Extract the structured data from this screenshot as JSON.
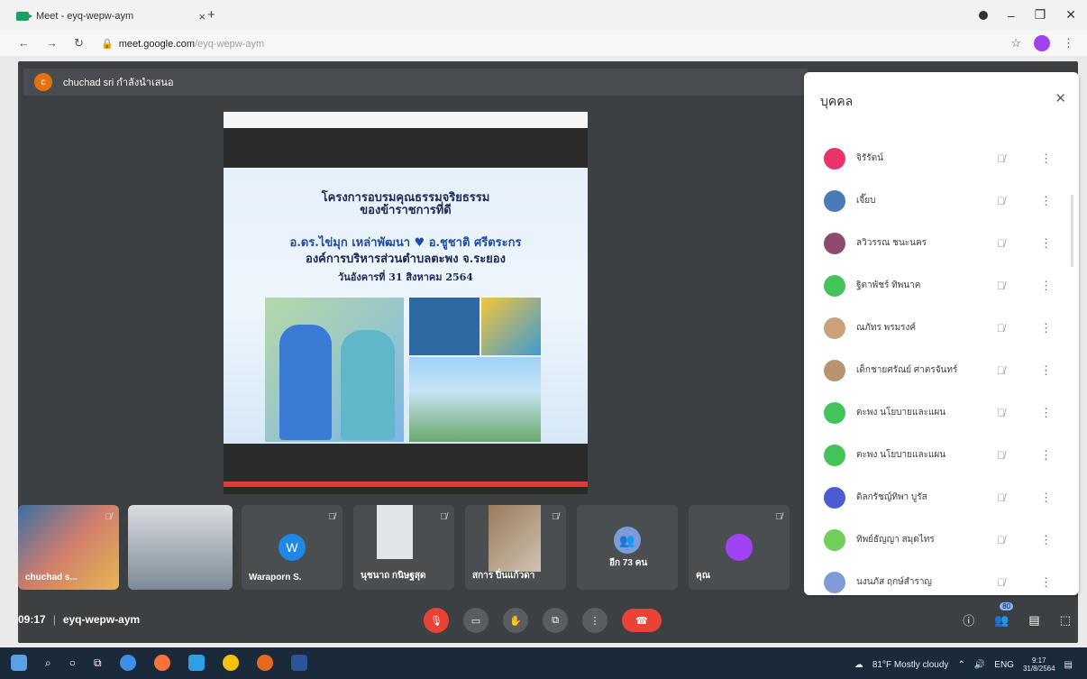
{
  "browser": {
    "tab_title": "Meet - eyq-wepw-aym",
    "tab_close": "×",
    "new_tab": "+",
    "url_host": "meet.google.com",
    "url_path": "/eyq-wepw-aym"
  },
  "presenter": {
    "avatar_initial": "c",
    "text": "chuchad sri กำลังนำเสนอ"
  },
  "slide": {
    "line1": "โครงการอบรมคุณธรรมจริยธรรม",
    "line2": "ของข้าราชการที่ดี",
    "line3": "อ.ดร.ไข่มุก เหล่าพัฒนา ♥ อ.ชูชาติ ศรีตระกร",
    "line4": "องค์การบริหารส่วนตำบลตะพง จ.ระยอง",
    "line5": "วันอังคารที่ 31 สิงหาคม 2564"
  },
  "tiles": [
    {
      "name": "chuchad s...",
      "initial": ""
    },
    {
      "name": "",
      "initial": ""
    },
    {
      "name": "Waraporn S.",
      "initial": "W"
    },
    {
      "name": "นุชนาถ กนิษฐสุด",
      "initial": ""
    },
    {
      "name": "สการ ปิ่นแก้วดา",
      "initial": ""
    },
    {
      "name": "อีก 73 คน",
      "initial": ""
    },
    {
      "name": "คุณ",
      "initial": ""
    }
  ],
  "meeting": {
    "time": "09:17",
    "separator": "|",
    "code": "eyq-wepw-aym",
    "participant_count": "80"
  },
  "panel": {
    "title": "บุคคล",
    "participants": [
      {
        "name": "จิรัรัตน์",
        "color": "#e8336b"
      },
      {
        "name": "เจี๊ยบ",
        "color": "#4a7bb7"
      },
      {
        "name": "ลวิวรรณ ชนะนคร",
        "color": "#8e4b6e"
      },
      {
        "name": "ฐิตาพัชร์ ทิพนาค",
        "color": "#43c45a"
      },
      {
        "name": "ณภัทร พรมรงค์",
        "color": "#c9a27a"
      },
      {
        "name": "เด็กชายศรัณย์ ศาตรจันทร์",
        "color": "#b89370"
      },
      {
        "name": "ตะพง นโยบายและแผน",
        "color": "#43c45a"
      },
      {
        "name": "ตะพง นโยบายและแผน",
        "color": "#43c45a"
      },
      {
        "name": "ดิลกรัชญ์ทิพา บูรัส",
        "color": "#4b5bd1"
      },
      {
        "name": "ทิพย์ธัญญา สมุดไทร",
        "color": "#6fcf5a"
      },
      {
        "name": "นงนภัส ฤกษ์สำราญ",
        "color": "#7f9bd8"
      }
    ]
  },
  "taskbar": {
    "weather": "81°F  Mostly cloudy",
    "lang": "ENG",
    "time": "9:17",
    "date": "31/8/2564"
  },
  "colors": {
    "meet_bg": "#3c4043",
    "accent_red": "#ea4335",
    "panel_bg": "#ffffff"
  }
}
